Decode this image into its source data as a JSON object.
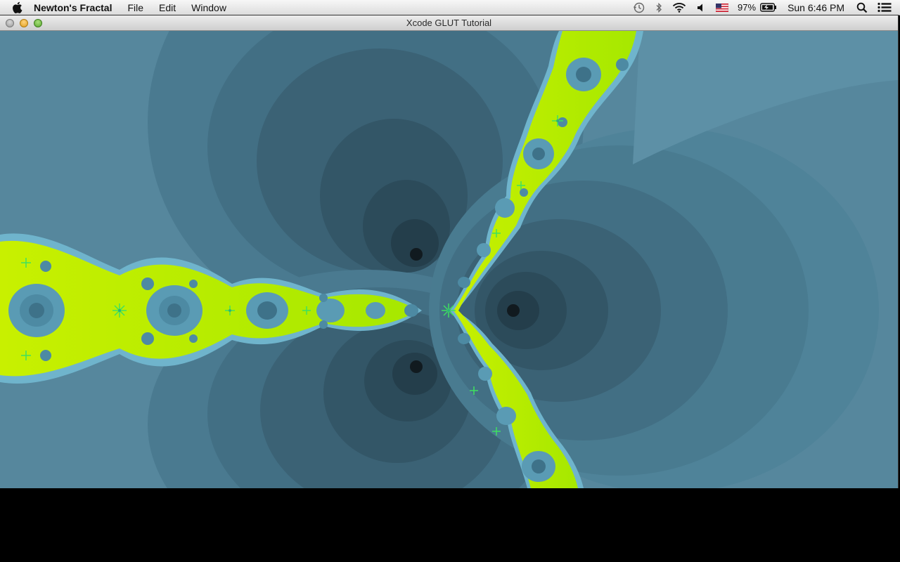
{
  "menubar": {
    "app_name": "Newton's Fractal",
    "menus": [
      "File",
      "Edit",
      "Window"
    ],
    "status": {
      "battery_percent": "97%",
      "clock": "Sun 6:46 PM",
      "icons": [
        "time-machine-icon",
        "bluetooth-icon",
        "wifi-icon",
        "volume-icon",
        "us-flag-input-icon",
        "battery-icon",
        "spotlight-icon",
        "notification-center-icon"
      ]
    }
  },
  "window": {
    "title": "Xcode GLUT Tutorial"
  },
  "fractal": {
    "colors": {
      "background": "#5a8aa0",
      "boundary_yellow": "#c8f000",
      "boundary_green": "#84d600",
      "basin_light": "#6fb4cc",
      "basin_dark": "#243a46",
      "root_dot": "#111a1f"
    }
  }
}
